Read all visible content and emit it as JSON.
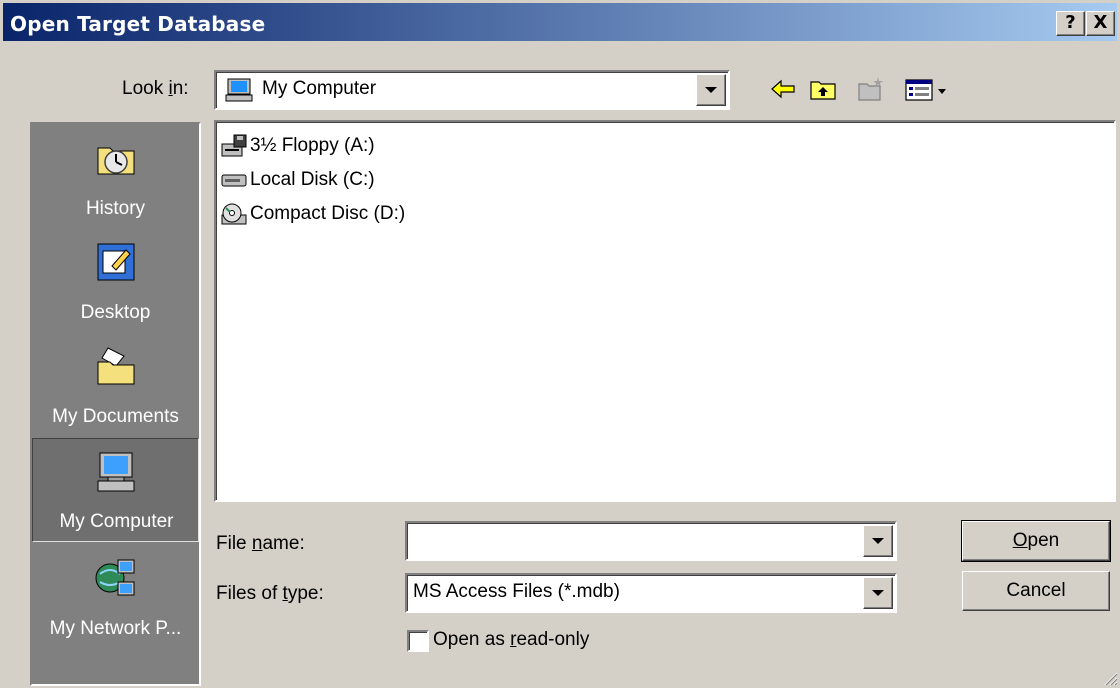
{
  "window": {
    "title": "Open Target Database",
    "help_label": "?",
    "close_label": "X"
  },
  "lookin": {
    "label": "Look in:",
    "label_pre": "Look ",
    "label_u": "i",
    "label_post": "n:",
    "value": "My Computer"
  },
  "places": [
    {
      "label": "History",
      "icon": "history-icon"
    },
    {
      "label": "Desktop",
      "icon": "desktop-icon"
    },
    {
      "label": "My Documents",
      "icon": "my-documents-icon"
    },
    {
      "label": "My Computer",
      "icon": "my-computer-icon",
      "selected": true
    },
    {
      "label": "My Network P...",
      "icon": "my-network-places-icon"
    }
  ],
  "files": [
    {
      "name": "3½ Floppy (A:)",
      "icon": "floppy-drive-icon"
    },
    {
      "name": "Local Disk (C:)",
      "icon": "hard-disk-icon"
    },
    {
      "name": "Compact Disc (D:)",
      "icon": "cd-drive-icon"
    }
  ],
  "filename": {
    "label_pre": "File ",
    "label_u": "n",
    "label_post": "ame:",
    "value": ""
  },
  "filetype": {
    "label_pre": "Files of ",
    "label_u": "t",
    "label_post": "ype:",
    "value": "MS Access Files (*.mdb)"
  },
  "readonly": {
    "label_pre": "Open as ",
    "label_u": "r",
    "label_post": "ead-only",
    "checked": false
  },
  "buttons": {
    "open_u": "O",
    "open_rest": "pen",
    "cancel": "Cancel"
  },
  "colors": {
    "titlebar_start": "#0a246a",
    "titlebar_end": "#a6caf0",
    "face": "#d4d0c8",
    "places_bg": "#808080"
  }
}
